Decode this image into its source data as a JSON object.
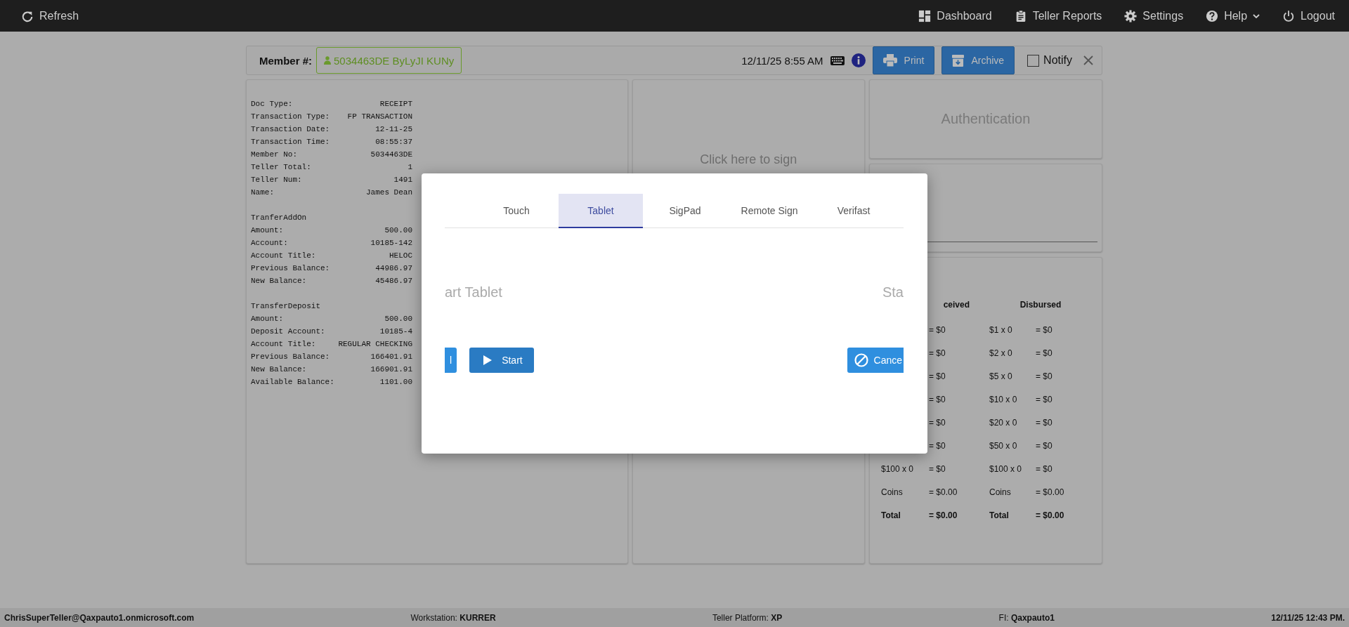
{
  "topbar": {
    "left": {
      "label": "Refresh",
      "kind": "refresh"
    },
    "items": [
      {
        "label": "Dashboard",
        "kind": "dashboard"
      },
      {
        "label": "Teller Reports",
        "kind": "reports"
      },
      {
        "label": "Settings",
        "kind": "settings"
      },
      {
        "label": "Help",
        "kind": "help"
      },
      {
        "label": "Logout",
        "kind": "logout"
      }
    ]
  },
  "header": {
    "member_label": "Member #:",
    "member_badge": "5034463DE ByLyJI KUNy",
    "datetime": "12/11/25 8:55 AM",
    "buttons": [
      {
        "label": "Print",
        "kind": "print"
      },
      {
        "label": "Archive",
        "kind": "archive"
      }
    ],
    "notify": {
      "label": "Notify",
      "checked": false
    }
  },
  "receipt": [
    {
      "lines": [
        {
          "label": "Doc Type:",
          "value": "RECEIPT"
        },
        {
          "label": "Transaction Type:",
          "value": "FP TRANSACTION"
        },
        {
          "label": "Transaction Date:",
          "value": "12-11-25"
        },
        {
          "label": "Transaction Time:",
          "value": "08:55:37"
        },
        {
          "label": "Member No:",
          "value": "5034463DE"
        },
        {
          "label": "Teller Total:",
          "value": "1"
        },
        {
          "label": "Teller Num:",
          "value": "1491"
        },
        {
          "label": "Name:",
          "value": "James Dean"
        }
      ]
    },
    {
      "heading": "TranferAddOn",
      "lines": [
        {
          "label": "Amount:",
          "value": "500.00"
        },
        {
          "label": "Account:",
          "value": "10185-142"
        },
        {
          "label": "Account Title:",
          "value": "HELOC"
        },
        {
          "label": "Previous Balance:",
          "value": "44986.97"
        },
        {
          "label": "New Balance:",
          "value": "45486.97"
        }
      ]
    },
    {
      "heading": "TransferDeposit",
      "lines": [
        {
          "label": "Amount:",
          "value": "500.00"
        },
        {
          "label": "Deposit Account:",
          "value": "10185-4"
        },
        {
          "label": "Account Title:",
          "value": "REGULAR CHECKING"
        },
        {
          "label": "Previous Balance:",
          "value": "166401.91"
        },
        {
          "label": "New Balance:",
          "value": "166901.91"
        },
        {
          "label": "Available Balance:",
          "value": "1101.00"
        }
      ]
    }
  ],
  "sign_panel": {
    "prompt": "Click here to sign"
  },
  "auth_panel": {
    "title": "Authentication"
  },
  "cash": {
    "received_heading": "ceived",
    "disbursed_heading": "Disbursed",
    "rows": [
      {
        "received_amount": "= $0",
        "disbursed_label": "$1 x 0",
        "disbursed_amount": "= $0",
        "kind": "plain"
      },
      {
        "received_amount": "= $0",
        "disbursed_label": "$2 x 0",
        "disbursed_amount": "= $0",
        "kind": "plain"
      },
      {
        "received_amount": "= $0",
        "disbursed_label": "$5 x 0",
        "disbursed_amount": "= $0",
        "kind": "plain"
      },
      {
        "received_amount": "= $0",
        "disbursed_label": "$10 x 0",
        "disbursed_amount": "= $0",
        "kind": "plain"
      },
      {
        "received_amount": "= $0",
        "disbursed_label": "$20 x 0",
        "disbursed_amount": "= $0",
        "kind": "plain"
      },
      {
        "received_amount": "= $0",
        "disbursed_label": "$50 x 0",
        "disbursed_amount": "= $0",
        "kind": "plain"
      },
      {
        "received_label": "$100 x 0",
        "received_amount": "= $0",
        "disbursed_label": "$100 x 0",
        "disbursed_amount": "= $0",
        "kind": "plain"
      },
      {
        "received_label": "Coins",
        "received_amount": "= $0.00",
        "disbursed_label": "Coins",
        "disbursed_amount": "= $0.00",
        "kind": "plain"
      },
      {
        "received_label": "Total",
        "received_amount": "= $0.00",
        "disbursed_label": "Total",
        "disbursed_amount": "= $0.00",
        "kind": "total"
      }
    ]
  },
  "modal": {
    "tabs": [
      {
        "label": "Touch",
        "selected": false
      },
      {
        "label": "Tablet",
        "selected": true
      },
      {
        "label": "SigPad",
        "selected": false
      },
      {
        "label": "Remote Sign",
        "selected": false
      },
      {
        "label": "Verifast",
        "selected": false
      }
    ],
    "left_prompt": "art Tablet",
    "right_prompt": "Sta",
    "buttons": [
      {
        "label": "l",
        "kind": "plain"
      },
      {
        "label": "Start",
        "kind": "start"
      },
      {
        "label": "Cance",
        "kind": "cancel"
      }
    ]
  },
  "status_bar": {
    "user": "ChrisSuperTeller@Qaxpauto1.onmicrosoft.com",
    "workstation": "Workstation: **KURRER**",
    "platform": "Teller Platform: **XP**",
    "fi": "FI: **Qaxpauto1**",
    "time": "12/11/25 12:43 PM."
  }
}
